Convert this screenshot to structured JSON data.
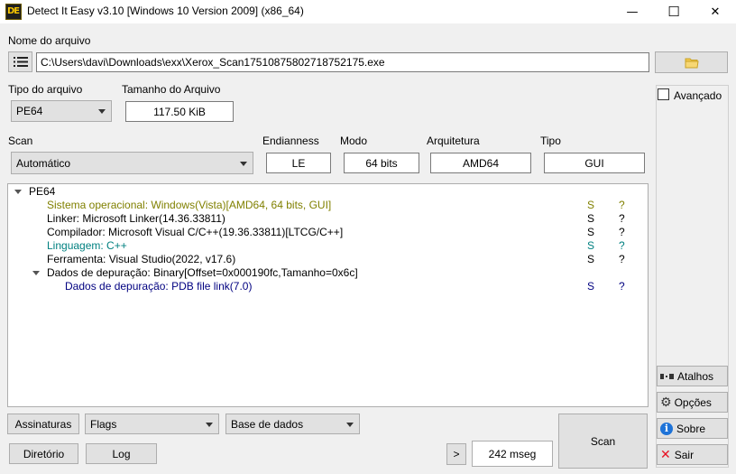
{
  "window": {
    "title": "Detect It Easy v3.10 [Windows 10 Version 2009] (x86_64)",
    "icon_text": "DE",
    "minimize_glyph": "—",
    "maximize_glyph": "☐",
    "close_glyph": "✕"
  },
  "file": {
    "label": "Nome do arquivo",
    "path": "C:\\Users\\davi\\Downloads\\exx\\Xerox_Scan17510875802718752175.exe"
  },
  "file_type": {
    "label": "Tipo do arquivo",
    "value": "PE64"
  },
  "file_size": {
    "label": "Tamanho do Arquivo",
    "value": "117.50 KiB"
  },
  "scan": {
    "label": "Scan",
    "value": "Automático"
  },
  "endianness": {
    "label": "Endianness",
    "value": "LE"
  },
  "mode": {
    "label": "Modo",
    "value": "64 bits"
  },
  "architecture": {
    "label": "Arquitetura",
    "value": "AMD64"
  },
  "type": {
    "label": "Tipo",
    "value": "GUI"
  },
  "results": {
    "root": "PE64",
    "items": [
      {
        "text": "Sistema operacional: Windows(Vista)[AMD64, 64 bits, GUI]",
        "color": "#808000",
        "s": "S",
        "q": "?"
      },
      {
        "text": "Linker: Microsoft Linker(14.36.33811)",
        "color": "#000000",
        "s": "S",
        "q": "?"
      },
      {
        "text": "Compilador: Microsoft Visual C/C++(19.36.33811)[LTCG/C++]",
        "color": "#000000",
        "s": "S",
        "q": "?"
      },
      {
        "text": "Linguagem: C++",
        "color": "#008080",
        "s": "S",
        "q": "?"
      },
      {
        "text": "Ferramenta: Visual Studio(2022, v17.6)",
        "color": "#000000",
        "s": "S",
        "q": "?"
      },
      {
        "text": "Dados de depuração: Binary[Offset=0x000190fc,Tamanho=0x6c]",
        "color": "#000000"
      },
      {
        "text": "Dados de depuração: PDB file link(7.0)",
        "color": "#000080",
        "s": "S",
        "q": "?"
      }
    ]
  },
  "bottom": {
    "signatures": "Assinaturas",
    "flags": "Flags",
    "database": "Base de dados",
    "directory": "Diretório",
    "log": "Log",
    "next": ">",
    "time": "242 mseg",
    "scan": "Scan"
  },
  "side": {
    "advanced": "Avançado",
    "shortcuts": "Atalhos",
    "options": "Opções",
    "about": "Sobre",
    "exit": "Sair"
  },
  "colors": {
    "folder": "#f2c94c",
    "about_icon": "#1e73d8",
    "exit_icon": "#e81123",
    "s_flag_blue": "#000080"
  }
}
